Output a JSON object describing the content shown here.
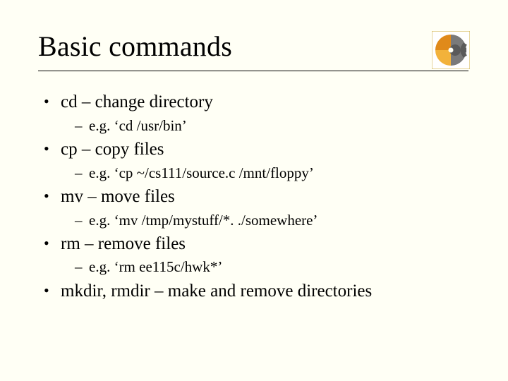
{
  "title": "Basic commands",
  "logo_name": "gear-sun-icon",
  "bullets": [
    {
      "text": "cd – change directory",
      "sub": [
        "e.g. ‘cd /usr/bin’"
      ]
    },
    {
      "text": "cp – copy files",
      "sub": [
        "e.g. ‘cp ~/cs111/source.c /mnt/floppy’"
      ]
    },
    {
      "text": "mv – move files",
      "sub": [
        "e.g. ‘mv /tmp/mystuff/*. ./somewhere’"
      ]
    },
    {
      "text": "rm – remove files",
      "sub": [
        "e.g. ‘rm ee115c/hwk*’"
      ]
    },
    {
      "text": "mkdir, rmdir – make and remove directories",
      "sub": []
    }
  ]
}
